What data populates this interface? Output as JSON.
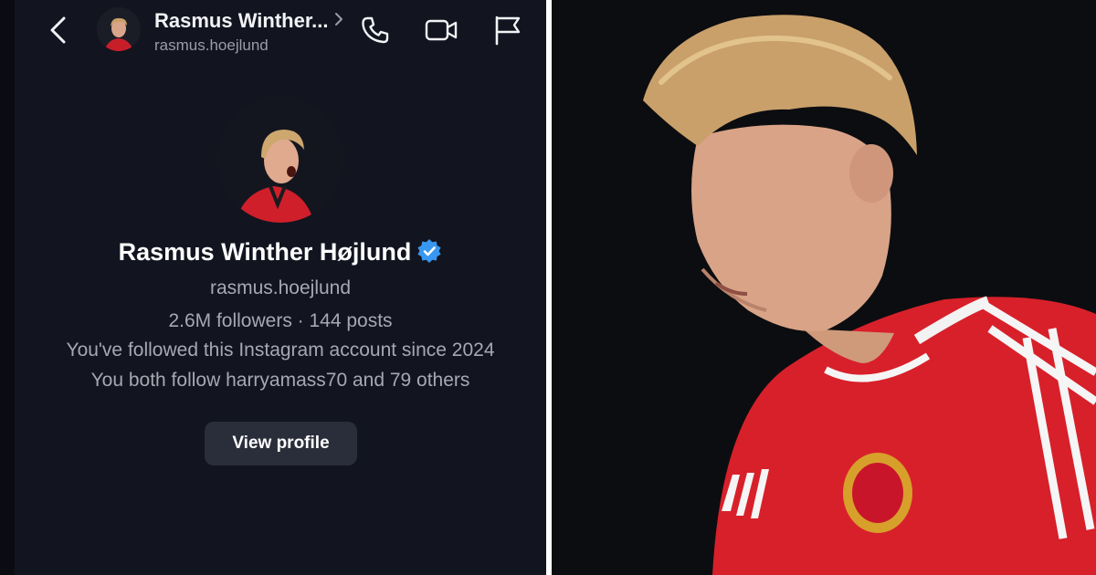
{
  "header": {
    "name": "Rasmus Winther...",
    "username": "rasmus.hoejlund"
  },
  "profile": {
    "full_name": "Rasmus Winther Højlund",
    "username": "rasmus.hoejlund",
    "stats": "2.6M followers · 144 posts",
    "follow_since": "You've followed this Instagram account since 2024",
    "mutual": "You both follow harryamass70 and 79 others",
    "view_button": "View profile"
  },
  "icons": [
    "back-arrow-icon",
    "chevron-right-icon",
    "phone-icon",
    "video-camera-icon",
    "flag-icon",
    "verified-badge-icon"
  ],
  "colors": {
    "background": "#121420",
    "verified": "#3897f0",
    "button": "#2a2d3a",
    "jersey": "#d8202a"
  }
}
